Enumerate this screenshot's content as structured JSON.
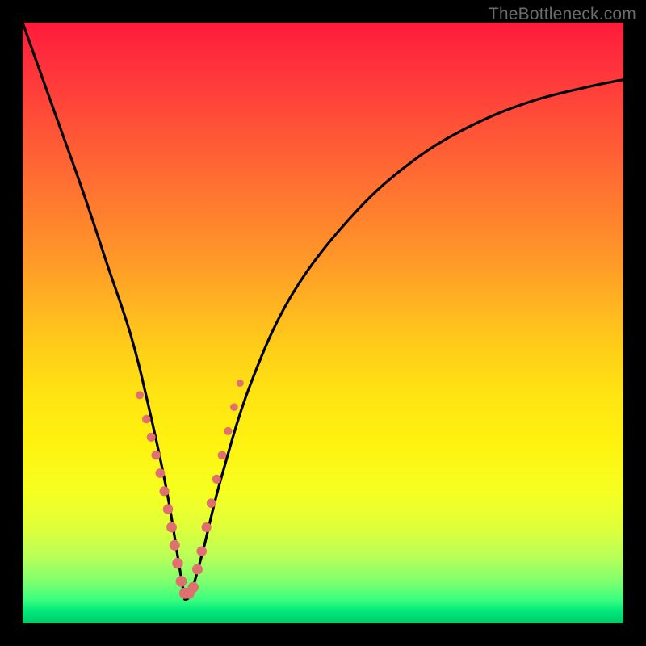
{
  "watermark": {
    "text": "TheBottleneck.com"
  },
  "chart_data": {
    "type": "line",
    "title": "",
    "xlabel": "",
    "ylabel": "",
    "xlim": [
      0,
      100
    ],
    "ylim": [
      0,
      100
    ],
    "grid": false,
    "legend": false,
    "trough_x": 27,
    "series": [
      {
        "name": "curve",
        "color": "#000000",
        "x": [
          0,
          5,
          10,
          14,
          18,
          21,
          24,
          26,
          27,
          28,
          30,
          33,
          38,
          45,
          55,
          65,
          75,
          85,
          95,
          100
        ],
        "values": [
          100,
          86,
          72,
          60,
          48,
          36,
          22,
          10,
          4,
          5,
          12,
          24,
          40,
          55,
          68,
          77,
          83,
          87,
          89.5,
          90.5
        ]
      }
    ],
    "markers": {
      "name": "dots",
      "color": "#e06f6f",
      "radius_range": [
        4.5,
        7
      ],
      "x": [
        19.5,
        20.6,
        21.4,
        22.2,
        22.9,
        23.6,
        24.2,
        24.8,
        25.3,
        25.8,
        26.4,
        27.0,
        27.7,
        28.4,
        29.1,
        29.8,
        30.6,
        31.4,
        32.3,
        33.2,
        34.2,
        35.2,
        36.2
      ],
      "values": [
        38,
        34,
        31,
        28,
        25,
        22,
        19,
        16,
        13,
        10,
        7,
        5,
        5,
        6,
        9,
        12,
        16,
        20,
        24,
        28,
        32,
        36,
        40
      ]
    }
  }
}
